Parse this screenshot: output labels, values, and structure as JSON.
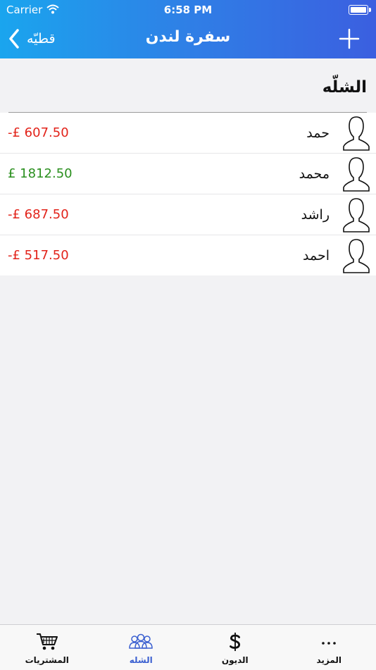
{
  "status_bar": {
    "carrier": "Carrier",
    "time": "6:58 PM"
  },
  "nav": {
    "back_label": "قطيّه",
    "title": "سفرة لندن"
  },
  "section": {
    "title": "الشلّه"
  },
  "members": [
    {
      "name": "حمد",
      "amount": "-£ 607.50",
      "status": "negative"
    },
    {
      "name": "محمد",
      "amount": "£ 1812.50",
      "status": "positive"
    },
    {
      "name": "راشد",
      "amount": "-£ 687.50",
      "status": "negative"
    },
    {
      "name": "احمد",
      "amount": "-£ 517.50",
      "status": "negative"
    }
  ],
  "tabs": [
    {
      "label": "المشتريات",
      "icon": "cart-icon"
    },
    {
      "label": "الشله",
      "icon": "group-icon"
    },
    {
      "label": "الديون",
      "icon": "dollar-icon"
    },
    {
      "label": "المزيد",
      "icon": "more-dots-icon"
    }
  ],
  "active_tab": "الشله",
  "colors": {
    "accent": "#3a5fd0",
    "negative": "#e2231a",
    "positive": "#2a8f1e",
    "header_start": "#1aa5ee",
    "header_end": "#3b5fe0"
  }
}
